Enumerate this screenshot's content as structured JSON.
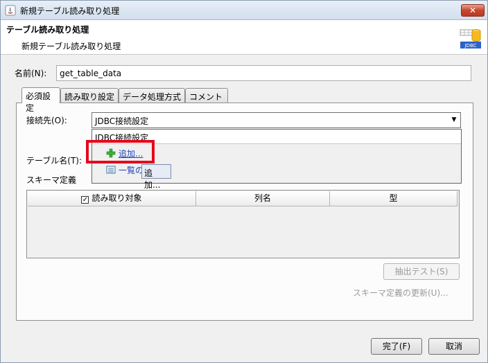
{
  "window": {
    "title": "新規テーブル読み取り処理",
    "close_label": "✕"
  },
  "header": {
    "title": "テーブル読み取り処理",
    "subtitle": "新規テーブル読み取り処理",
    "badge": "JDBC"
  },
  "name_field": {
    "label": "名前(N):",
    "value": "get_table_data"
  },
  "tabs": [
    {
      "label": "必須設定",
      "active": true
    },
    {
      "label": "読み取り設定",
      "active": false
    },
    {
      "label": "データ処理方式",
      "active": false
    },
    {
      "label": "コメント",
      "active": false
    }
  ],
  "connection": {
    "label": "接続先(O):",
    "selected": "JDBC接続設定",
    "dropdown": {
      "header": "JDBC接続設定",
      "items": [
        {
          "label": "追加...",
          "icon": "add-icon"
        },
        {
          "label": "一覧の",
          "icon": "list-icon"
        }
      ],
      "tooltip": "追加..."
    }
  },
  "table_name": {
    "label": "テーブル名(T):"
  },
  "schema": {
    "label": "スキーマ定義",
    "columns": [
      "読み取り対象",
      "列名",
      "型"
    ]
  },
  "buttons": {
    "extract_test": "抽出テスト(S)",
    "update_schema": "スキーマ定義の更新(U)...",
    "finish": "完了(F)",
    "cancel": "取消"
  },
  "colors": {
    "highlight": "#e5081b",
    "link": "#1a3fc0"
  }
}
